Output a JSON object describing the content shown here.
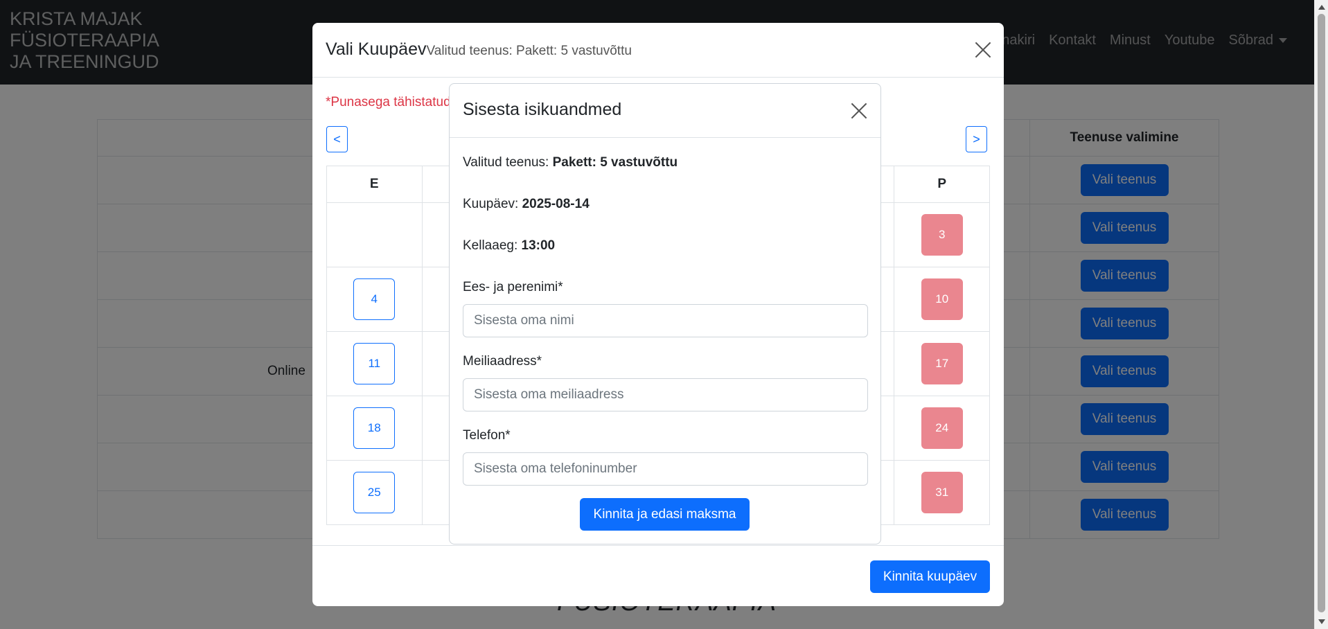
{
  "navbar": {
    "brand": "KRISTA MAJAK\nFÜSIOTERAAPIA\nJA TREENINGUD",
    "links": [
      "nnakiri",
      "Kontakt",
      "Minust",
      "Youtube",
      "Sõbrad"
    ]
  },
  "background_page": {
    "table_header_service": "Teenuse valimine",
    "row_text_online": "Online",
    "row_button_label": "Vali teenus",
    "footer_title": "FÜSIOTERAAPIA"
  },
  "date_modal": {
    "title": "Vali Kuupäev",
    "subtitle": "Valitud teenus: Pakett: 5 vastuvõttu",
    "required_note": "*Punasega tähistatud",
    "prev_label": "<",
    "next_label": ">",
    "weekday_first": "E",
    "weekday_last": "P",
    "weeks": [
      {
        "first": "",
        "last": "3"
      },
      {
        "first": "4",
        "last": "10"
      },
      {
        "first": "11",
        "last": "17"
      },
      {
        "first": "18",
        "last": "24"
      },
      {
        "first": "25",
        "last": "31"
      }
    ],
    "confirm_button": "Kinnita kuupäev"
  },
  "personal_modal": {
    "title": "Sisesta isikuandmed",
    "service_label": "Valitud teenus: ",
    "service_value": "Pakett: 5 vastuvõttu",
    "date_label": "Kuupäev: ",
    "date_value": "2025-08-14",
    "time_label": "Kellaaeg: ",
    "time_value": "13:00",
    "name_label": "Ees- ja perenimi*",
    "name_placeholder": "Sisesta oma nimi",
    "email_label": "Meiliaadress*",
    "email_placeholder": "Sisesta oma meiliaadress",
    "phone_label": "Telefon*",
    "phone_placeholder": "Sisesta oma telefoninumber",
    "submit_button": "Kinnita ja edasi maksma"
  },
  "colors": {
    "primary": "#0d6efd",
    "closed_day": "#ea868f",
    "required_text": "#dc3545",
    "navbar_bg": "#212529"
  }
}
